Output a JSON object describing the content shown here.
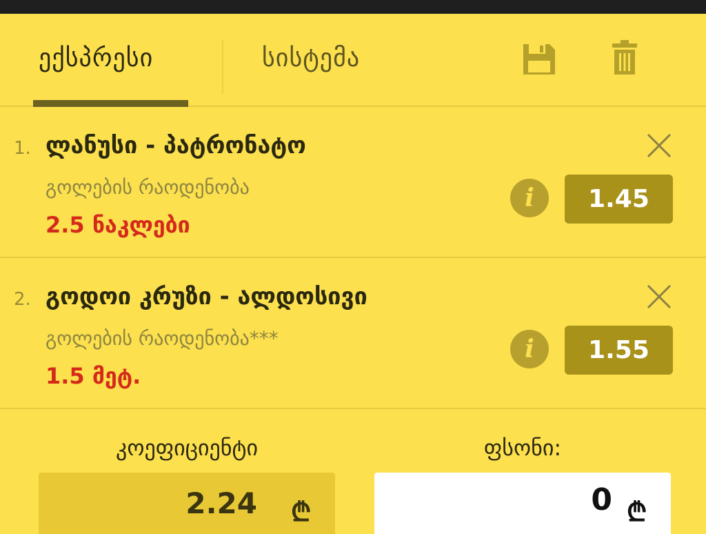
{
  "tabs": [
    {
      "label": "ექსპრესი",
      "active": true
    },
    {
      "label": "სისტემა",
      "active": false
    }
  ],
  "icons": {
    "save": "save-icon",
    "trash": "trash-icon",
    "close": "close-icon",
    "info": "info-icon",
    "info_glyph": "i",
    "currency": "₾"
  },
  "bets": [
    {
      "number": "1.",
      "title": "ლანუსი - პატრონატო",
      "market": "გოლების რაოდენობა",
      "selection": "2.5 ნაკლები",
      "odds": "1.45"
    },
    {
      "number": "2.",
      "title": "გოდოი კრუზი - ალდოსივი",
      "market": "გოლების რაოდენობა***",
      "selection": "1.5 მეტ.",
      "odds": "1.55"
    }
  ],
  "summary": {
    "coefficient_label": "კოეფიციენტი",
    "coefficient_value": "2.24",
    "stake_label": "ფსონი:",
    "stake_value": "0"
  },
  "colors": {
    "background": "#fce04e",
    "odds_box": "#a8921a",
    "selection_red": "#d42a1b",
    "dark_text": "#2b2810"
  }
}
